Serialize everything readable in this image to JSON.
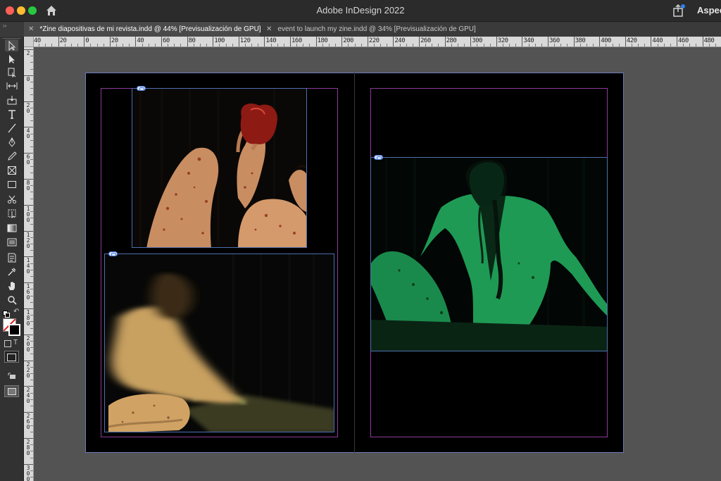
{
  "window": {
    "title": "Adobe InDesign 2022",
    "workspace_label": "Aspec"
  },
  "tabs": [
    {
      "label": "*Zine diapositivas de mi revista.indd @ 44% [Previsualización de GPU]",
      "active": true
    },
    {
      "label": "event to launch my zine.indd @ 34% [Previsualización de GPU]",
      "active": false
    }
  ],
  "rulers": {
    "horizontal": [
      "40",
      "20",
      "0",
      "20",
      "40",
      "60",
      "80",
      "100",
      "120",
      "140",
      "160",
      "180",
      "200",
      "220",
      "240",
      "260",
      "280",
      "300",
      "320",
      "340",
      "360",
      "380",
      "400",
      "420",
      "440",
      "460",
      "480"
    ],
    "vertical": [
      "2",
      "0",
      "2 0",
      "4 0",
      "6 0",
      "8 0",
      "1 0 0",
      "1 2 0",
      "1 4 0",
      "1 6 0",
      "1 8 0",
      "2 0 0",
      "2 2 0",
      "2 4 0",
      "2 6 0",
      "2 8 0",
      "3 0 0"
    ]
  },
  "tools": [
    "selection-tool-icon",
    "direct-selection-tool-icon",
    "page-tool-icon",
    "gap-tool-icon",
    "content-collector-tool-icon",
    "type-tool-icon",
    "line-tool-icon",
    "pen-tool-icon",
    "pencil-tool-icon",
    "rectangle-frame-tool-icon",
    "rectangle-tool-icon",
    "scissors-tool-icon",
    "free-transform-tool-icon",
    "gradient-swatch-tool-icon",
    "gradient-feather-tool-icon",
    "note-tool-icon",
    "eyedropper-tool-icon",
    "hand-tool-icon",
    "zoom-tool-icon"
  ],
  "document": {
    "images": [
      {
        "name": "photo-red-apple",
        "description_colors": [
          "#2a1208",
          "#c46a45",
          "#8e1a14"
        ]
      },
      {
        "name": "photo-motion-blur",
        "description_colors": [
          "#0a0a08",
          "#c8a060",
          "#5a6030"
        ]
      },
      {
        "name": "photo-green-figure",
        "description_colors": [
          "#021208",
          "#1e9a55",
          "#0a2a14"
        ]
      }
    ]
  },
  "colors": {
    "margin_guide": "#8d3b99",
    "frame_edge": "#4f6fb0",
    "page_bg": "#000000",
    "pasteboard": "#535353"
  }
}
